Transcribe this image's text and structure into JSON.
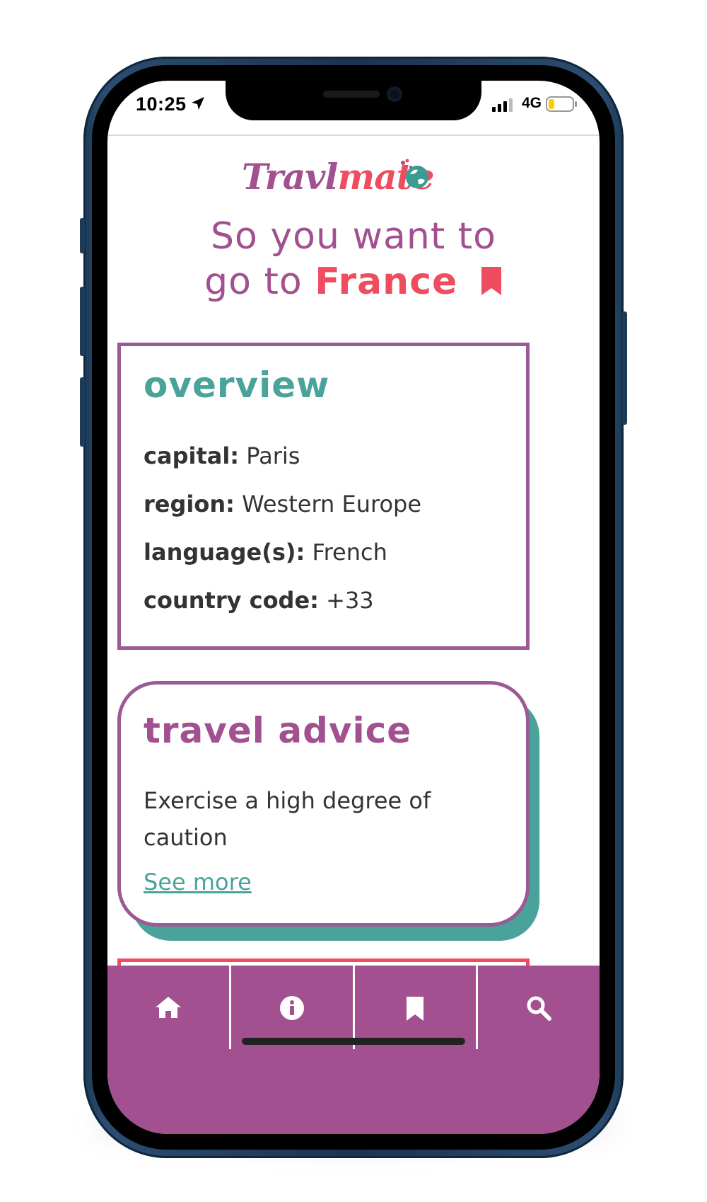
{
  "status_bar": {
    "time": "10:25",
    "network": "4G",
    "icons": [
      "location-arrow-icon",
      "signal-bars-icon",
      "battery-low-icon"
    ]
  },
  "app": {
    "logo_part1": "Travl",
    "logo_part2": "mate",
    "brand_colors": {
      "purple": "#a2508f",
      "coral": "#ee4d5f",
      "teal": "#4aa39a"
    }
  },
  "headline": {
    "prefix_line1": "So you want to",
    "prefix_line2": "go to",
    "country": "France",
    "bookmark_icon": "bookmark-icon"
  },
  "overview": {
    "title": "overview",
    "rows": [
      {
        "label": "capital:",
        "value": "Paris"
      },
      {
        "label": "region:",
        "value": "Western Europe"
      },
      {
        "label": "language(s):",
        "value": "French"
      },
      {
        "label": "country code:",
        "value": "+33"
      }
    ]
  },
  "travel_advice": {
    "title": "travel advice",
    "text": "Exercise a high degree of caution",
    "link": "See more"
  },
  "tab_bar": {
    "tabs": [
      {
        "icon": "home-icon"
      },
      {
        "icon": "info-icon"
      },
      {
        "icon": "bookmark-icon"
      },
      {
        "icon": "search-icon"
      }
    ]
  }
}
